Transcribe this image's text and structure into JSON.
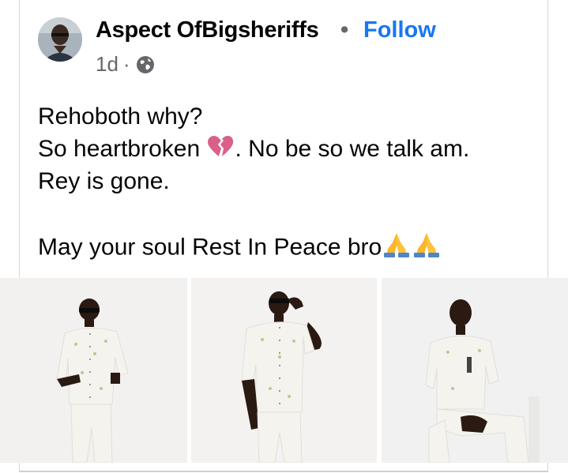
{
  "post": {
    "author_name": "Aspect OfBigsheriffs",
    "separator": "•",
    "follow_label": "Follow",
    "timestamp": "1d",
    "meta_separator": "·",
    "audience_icon": "globe-icon",
    "lines": {
      "l1": "Rehoboth why?",
      "l2_a": "So heartbroken ",
      "l2_b": ". No be so we talk am.",
      "l3": "Rey is gone.",
      "l5": "May your soul Rest In Peace bro"
    },
    "emojis": [
      "broken-heart-icon",
      "folded-hands-icon",
      "folded-hands-icon"
    ],
    "photos_count": 3
  },
  "colors": {
    "link_blue": "#1877f2",
    "secondary_text": "#65676b",
    "text": "#050505",
    "photo_bg": "#efefee",
    "outfit": "#f4f3ee"
  }
}
